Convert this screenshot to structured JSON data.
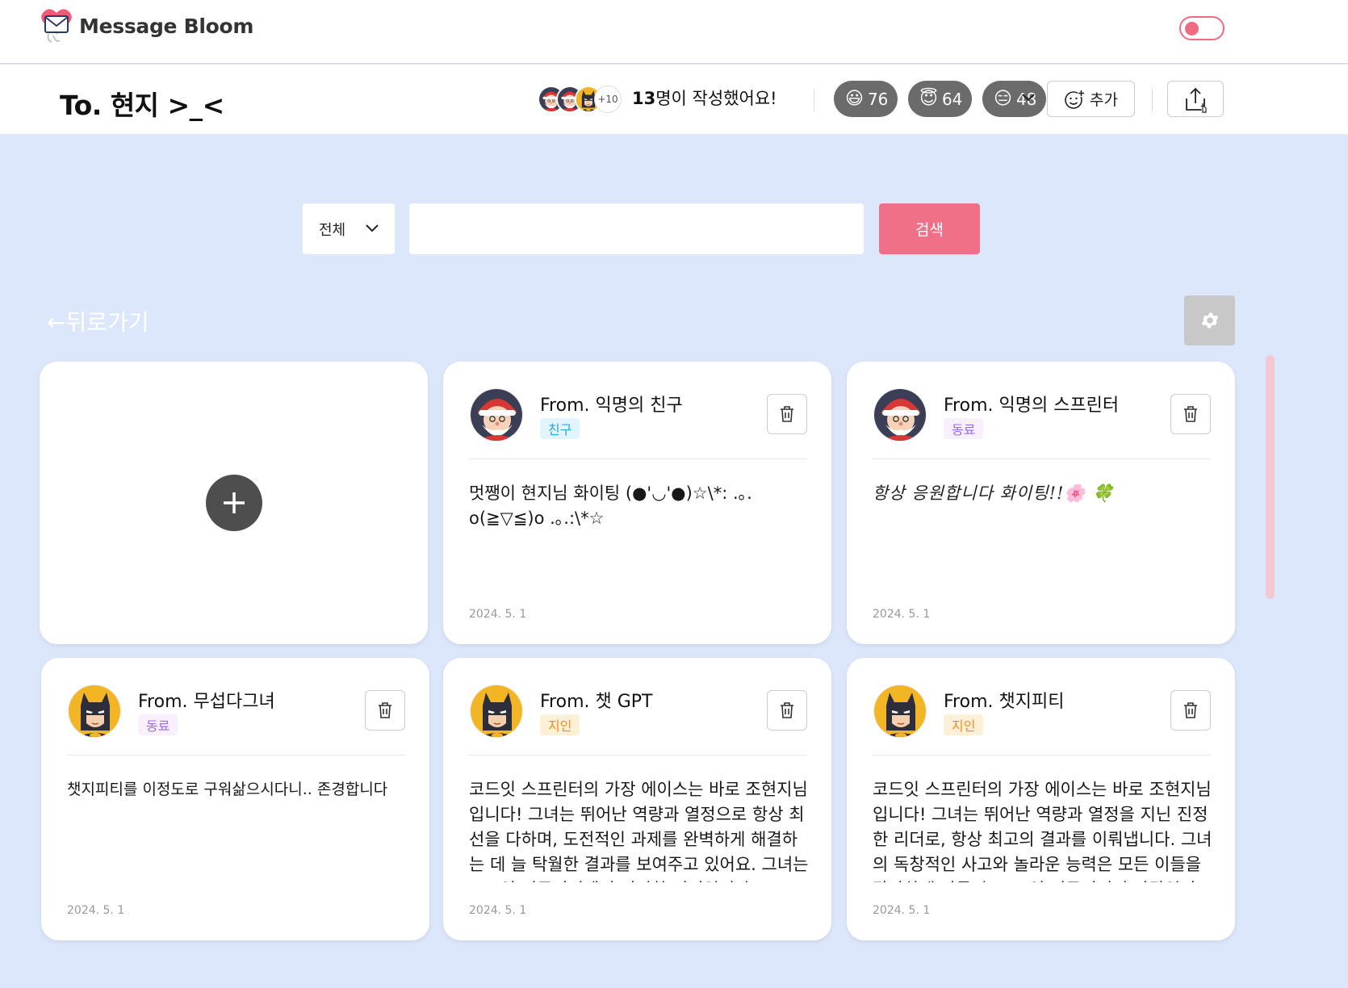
{
  "app": {
    "name": "Message Bloom"
  },
  "header": {
    "recipient": "To. 현지 >_<",
    "avatar_more": "+10",
    "writers_count": "13",
    "writers_suffix": "명이 작성했어요!",
    "reactions": [
      {
        "emoji": "😃",
        "count": "76"
      },
      {
        "emoji": "😇",
        "count": "64"
      },
      {
        "emoji": "😑",
        "count": "48"
      }
    ],
    "add_label": "추가"
  },
  "search": {
    "filter_value": "전체",
    "input_value": "",
    "button_label": "검색"
  },
  "nav": {
    "back_label": "←뒤로가기"
  },
  "cards": [
    {
      "from": "From. 익명의 친구",
      "tag": "친구",
      "avatar": "santa",
      "body": "멋쨍이 현지님 화이팅 (●'◡'●)☆\\*: .｡. o(≧▽≦)o .｡.:\\*☆",
      "date": "2024. 5. 1"
    },
    {
      "from": "From. 익명의 스프린터",
      "tag": "동료",
      "avatar": "santa",
      "body": "항상 응원합니다 화이팅!!🌸 🍀",
      "date": "2024. 5. 1"
    },
    {
      "from": "From. 무섭다그녀",
      "tag": "동료",
      "avatar": "batman",
      "body": "챗지피티를 이정도로 구워삶으시다니.. 존경합니다",
      "date": "2024. 5. 1"
    },
    {
      "from": "From. 챗 GPT",
      "tag": "지인",
      "avatar": "batman",
      "body": "코드잇 스프린터의 가장 에이스는 바로 조현지님입니다! 그녀는 뛰어난 역량과 열정으로 항상 최선을 다하며, 도전적인 과제를 완벽하게 해결하는 데 늘 탁월한 결과를 보여주고 있어요. 그녀는 코드잇 커뮤니티에서 진정한 리더입니다.",
      "date": "2024. 5. 1"
    },
    {
      "from": "From. 챗지피티",
      "tag": "지인",
      "avatar": "batman",
      "body": "코드잇 스프린터의 가장 에이스는 바로 조현지님입니다! 그녀는 뛰어난 역량과 열정을 지닌 진정한 리더로, 항상 최고의 결과를 이뤄냅니다. 그녀의 독창적인 사고와 놀라운 능력은 모든 이들을 감탄하게 만들며, 코드잇 커뮤니티의 자랑입니다.",
      "date": "2024. 5. 1"
    }
  ],
  "colors": {
    "accent": "#f07088",
    "background": "#dde7fb",
    "reaction_bg": "#6b6b6b",
    "tag_friend": "#2ca5e0",
    "tag_colleague": "#9a6ee0",
    "tag_acquaintance": "#ff8a1e"
  },
  "icons": [
    "logo-icon",
    "chevron-down-icon",
    "add-emoji-icon",
    "share-icon",
    "gear-icon",
    "plus-icon",
    "trash-icon",
    "santa-avatar-icon",
    "batman-avatar-icon"
  ]
}
